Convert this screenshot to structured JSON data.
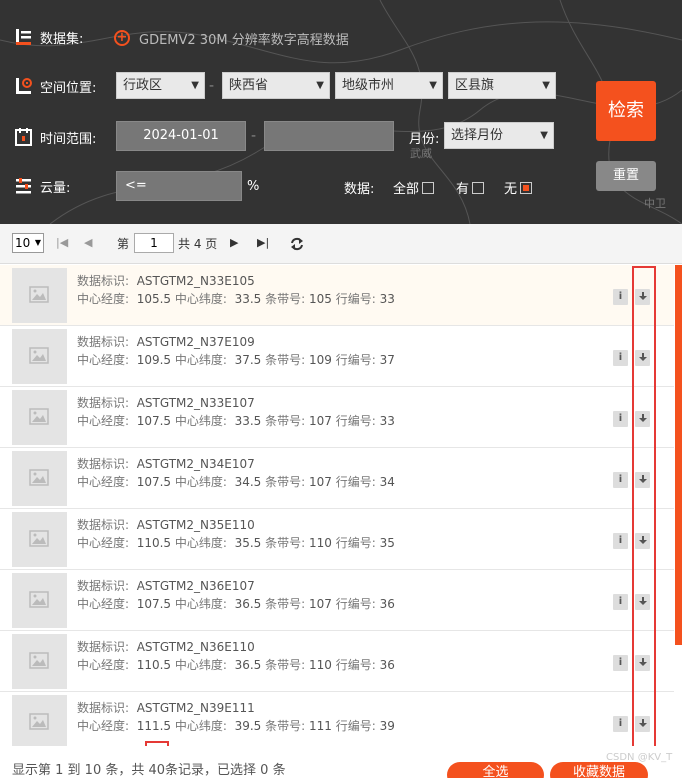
{
  "search": {
    "dataset_label": "数据集:",
    "dataset_value": "GDEMV2 30M 分辨率数字高程数据",
    "location_label": "空间位置:",
    "region_type": "行政区",
    "province": "陕西省",
    "city": "地级市州",
    "county": "区县旗",
    "time_label": "时间范围:",
    "start_date": "2024-01-01",
    "end_date": "",
    "month_label": "月份:",
    "month_value": "选择月份",
    "cloud_label": "云量:",
    "cloud_value": "<=",
    "cloud_unit": "%",
    "data_label": "数据:",
    "opt_all": "全部",
    "opt_has": "有",
    "opt_none": "无",
    "search_button": "检索",
    "reset_button": "重置",
    "map_labels": [
      "武威",
      "中卫"
    ]
  },
  "pager": {
    "page_size": "10",
    "page_prefix": "第",
    "current_page": "1",
    "page_suffix": "共 4 页"
  },
  "records": [
    {
      "id_label": "数据标识:",
      "id": "ASTGTM2_N33E105",
      "lon_label": "中心经度:",
      "lon": "105.5",
      "lat_label": "中心纬度:",
      "lat": "33.5",
      "path_label": "条带号:",
      "path": "105",
      "row_label": "行编号:",
      "row": "33"
    },
    {
      "id_label": "数据标识:",
      "id": "ASTGTM2_N37E109",
      "lon_label": "中心经度:",
      "lon": "109.5",
      "lat_label": "中心纬度:",
      "lat": "37.5",
      "path_label": "条带号:",
      "path": "109",
      "row_label": "行编号:",
      "row": "37"
    },
    {
      "id_label": "数据标识:",
      "id": "ASTGTM2_N33E107",
      "lon_label": "中心经度:",
      "lon": "107.5",
      "lat_label": "中心纬度:",
      "lat": "33.5",
      "path_label": "条带号:",
      "path": "107",
      "row_label": "行编号:",
      "row": "33"
    },
    {
      "id_label": "数据标识:",
      "id": "ASTGTM2_N34E107",
      "lon_label": "中心经度:",
      "lon": "107.5",
      "lat_label": "中心纬度:",
      "lat": "34.5",
      "path_label": "条带号:",
      "path": "107",
      "row_label": "行编号:",
      "row": "34"
    },
    {
      "id_label": "数据标识:",
      "id": "ASTGTM2_N35E110",
      "lon_label": "中心经度:",
      "lon": "110.5",
      "lat_label": "中心纬度:",
      "lat": "35.5",
      "path_label": "条带号:",
      "path": "110",
      "row_label": "行编号:",
      "row": "35"
    },
    {
      "id_label": "数据标识:",
      "id": "ASTGTM2_N36E107",
      "lon_label": "中心经度:",
      "lon": "107.5",
      "lat_label": "中心纬度:",
      "lat": "36.5",
      "path_label": "条带号:",
      "path": "107",
      "row_label": "行编号:",
      "row": "36"
    },
    {
      "id_label": "数据标识:",
      "id": "ASTGTM2_N36E110",
      "lon_label": "中心经度:",
      "lon": "110.5",
      "lat_label": "中心纬度:",
      "lat": "36.5",
      "path_label": "条带号:",
      "path": "110",
      "row_label": "行编号:",
      "row": "36"
    },
    {
      "id_label": "数据标识:",
      "id": "ASTGTM2_N39E111",
      "lon_label": "中心经度:",
      "lon": "111.5",
      "lat_label": "中心纬度:",
      "lat": "39.5",
      "path_label": "条带号:",
      "path": "111",
      "row_label": "行编号:",
      "row": "39"
    }
  ],
  "record_actions": {
    "info": "i",
    "download": "download-icon"
  },
  "footer": {
    "summary_before": "显示第 1 到 10 条，共 ",
    "total": "40",
    "summary_after": "条记录，已选择 0 条",
    "select_all": "全选",
    "favorite": "收藏数据",
    "watermark": "CSDN @KV_T"
  },
  "colors": {
    "accent": "#f4511e",
    "panel_bg": "#333333",
    "annotation_box": "#e53935"
  }
}
